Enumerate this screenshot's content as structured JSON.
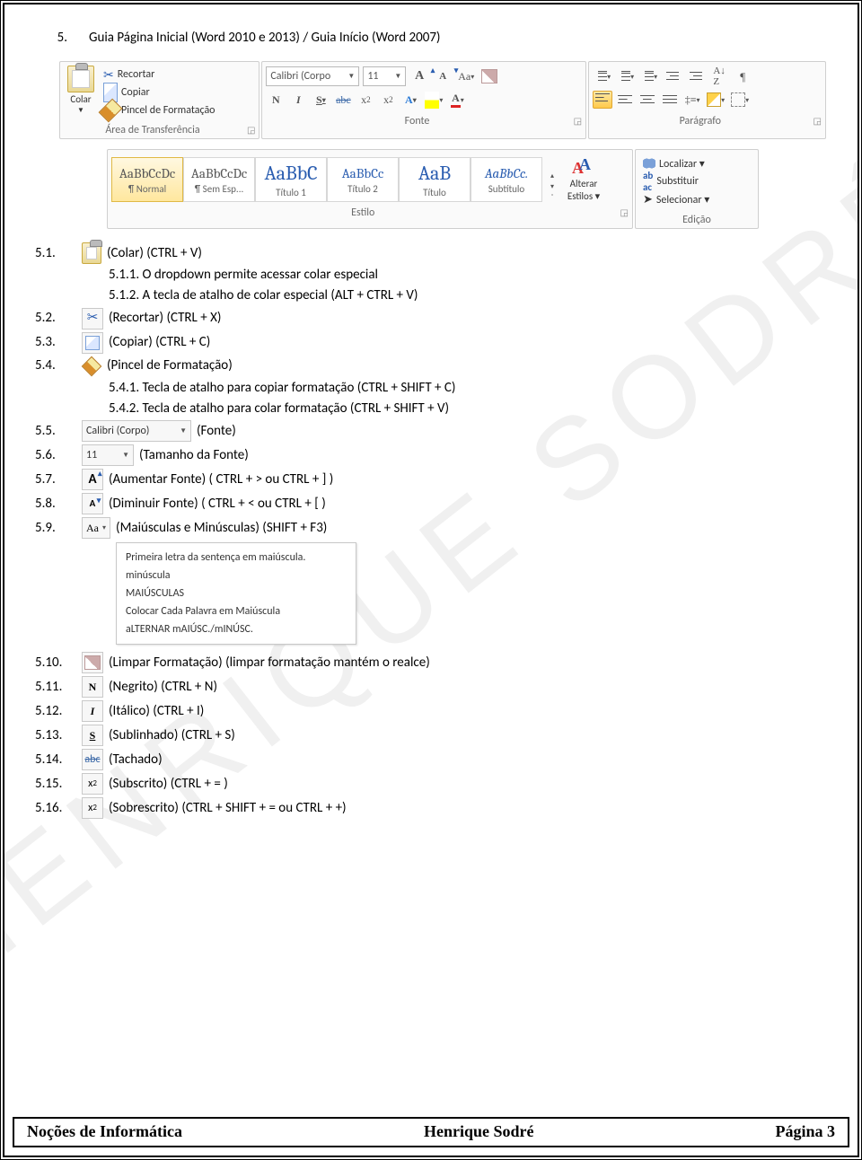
{
  "watermark": "HENRIQUE SODRÉ",
  "heading": {
    "num": "5.",
    "text": "Guia Página Inicial (Word 2010 e 2013) / Guia Início (Word 2007)"
  },
  "ribbon1": {
    "clipboard": {
      "paste": "Colar",
      "cut": "Recortar",
      "copy": "Copiar",
      "format_painter": "Pincel de Formatação",
      "label": "Área de Transferência"
    },
    "font": {
      "name": "Calibri (Corpo",
      "size": "11",
      "label": "Fonte"
    },
    "paragraph": {
      "label": "Parágrafo"
    }
  },
  "ribbon2": {
    "styles": [
      {
        "sample": "AaBbCcDc",
        "label": "¶ Normal",
        "blue": false,
        "big": false,
        "sel": true
      },
      {
        "sample": "AaBbCcDc",
        "label": "¶ Sem Esp...",
        "blue": false,
        "big": false,
        "sel": false
      },
      {
        "sample": "AaBbC",
        "label": "Título 1",
        "blue": true,
        "big": true,
        "sel": false
      },
      {
        "sample": "AaBbCc",
        "label": "Título 2",
        "blue": true,
        "big": false,
        "sel": false
      },
      {
        "sample": "AaB",
        "label": "Título",
        "blue": true,
        "big": true,
        "sel": false
      },
      {
        "sample": "AaBbCc.",
        "label": "Subtítulo",
        "blue": true,
        "big": false,
        "italic": true,
        "sel": false
      }
    ],
    "styles_label": "Estilo",
    "change_styles_top": "Alterar",
    "change_styles_bot": "Estilos ▾",
    "edit": {
      "find": "Localizar ▾",
      "replace": "Substituir",
      "select": "Selecionar ▾",
      "label": "Edição"
    }
  },
  "i51": {
    "n": "5.1.",
    "t": "(Colar) (CTRL + V)"
  },
  "i511": "5.1.1.   O dropdown permite acessar colar especial",
  "i512": "5.1.2.   A tecla de atalho de colar especial (ALT + CTRL + V)",
  "i52": {
    "n": "5.2.",
    "t": "(Recortar) (CTRL + X)"
  },
  "i53": {
    "n": "5.3.",
    "t": "(Copiar) (CTRL + C)"
  },
  "i54": {
    "n": "5.4.",
    "t": "(Pincel de Formatação)"
  },
  "i541": "5.4.1.   Tecla de atalho para copiar formatação (CTRL + SHIFT + C)",
  "i542": "5.4.2.   Tecla de atalho para colar formatação (CTRL + SHIFT + V)",
  "i55": {
    "n": "5.5.",
    "box": "Calibri (Corpo)",
    "t": "(Fonte)"
  },
  "i56": {
    "n": "5.6.",
    "box": "11",
    "t": "(Tamanho da Fonte)"
  },
  "i57": {
    "n": "5.7.",
    "t": "(Aumentar Fonte) ( CTRL + > ou CTRL + ] )"
  },
  "i58": {
    "n": "5.8.",
    "t": "(Diminuir Fonte) ( CTRL + < ou CTRL + [ )"
  },
  "i59": {
    "n": "5.9.",
    "t": "(Maiúsculas e Minúsculas) (SHIFT + F3)"
  },
  "case_menu": [
    "Primeira letra da sentença em maiúscula.",
    "minúscula",
    "MAIÚSCULAS",
    "Colocar Cada Palavra em Maiúscula",
    "aLTERNAR mAIÚSC./mINÚSC."
  ],
  "i510": {
    "n": "5.10.",
    "t": "(Limpar Formatação) (limpar formatação mantém o realce)"
  },
  "i511b": {
    "n": "5.11.",
    "t": "(Negrito) (CTRL + N)"
  },
  "i512b": {
    "n": "5.12.",
    "t": "(Itálico) (CTRL + I)"
  },
  "i513": {
    "n": "5.13.",
    "t": "(Sublinhado) (CTRL + S)"
  },
  "i514": {
    "n": "5.14.",
    "t": "(Tachado)"
  },
  "i515": {
    "n": "5.15.",
    "t": "(Subscrito) (CTRL + = )"
  },
  "i516": {
    "n": "5.16.",
    "t": "(Sobrescrito) (CTRL + SHIFT + =  ou CTRL + +)"
  },
  "footer": {
    "left": "Noções de Informática",
    "center": "Henrique Sodré",
    "right": "Página 3"
  }
}
